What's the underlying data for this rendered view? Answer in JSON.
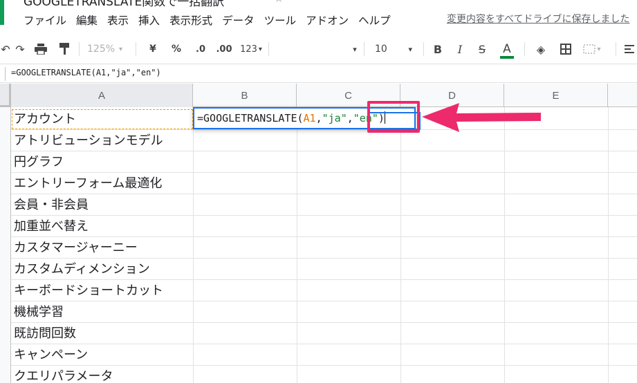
{
  "app": {
    "title": "GOOGLETRANSLATE関数で一括翻訳",
    "save_status": "変更内容をすべてドライブに保存しました"
  },
  "menu": [
    "ファイル",
    "編集",
    "表示",
    "挿入",
    "表示形式",
    "データ",
    "ツール",
    "アドオン",
    "ヘルプ"
  ],
  "toolbar": {
    "zoom": "125%",
    "currency": "¥",
    "percent": "%",
    "decimal_decrease": ".0",
    "decimal_increase": ".00",
    "more_formats": "123",
    "font_size": "10",
    "bold": "B",
    "italic": "I",
    "strikethrough": "S",
    "text_color": "A",
    "accent_color": "#0a8a3d"
  },
  "formula_bar": {
    "formula": "=GOOGLETRANSLATE(A1,\"ja\",\"en\")"
  },
  "columns": [
    "A",
    "B",
    "C",
    "D",
    "E"
  ],
  "cells_a": [
    "アカウント",
    "アトリビューションモデル",
    "円グラフ",
    "エントリーフォーム最適化",
    "会員・非会員",
    "加重並べ替え",
    "カスタマージャーニー",
    "カスタムディメンション",
    "キーボードショートカット",
    "機械学習",
    "既訪問回数",
    "キャンペーン",
    "クエリパラメータ"
  ],
  "editor": {
    "prefix": "=GOOGLETRANSLATE(",
    "ref": "A1",
    "sep1": ",",
    "arg1": "\"ja\"",
    "sep2": ",",
    "arg2": "\"en\"",
    "suffix": ")"
  },
  "colors": {
    "highlight": "#ec2a6c",
    "selection": "#1a73e8",
    "copy_border": "#f29900"
  }
}
